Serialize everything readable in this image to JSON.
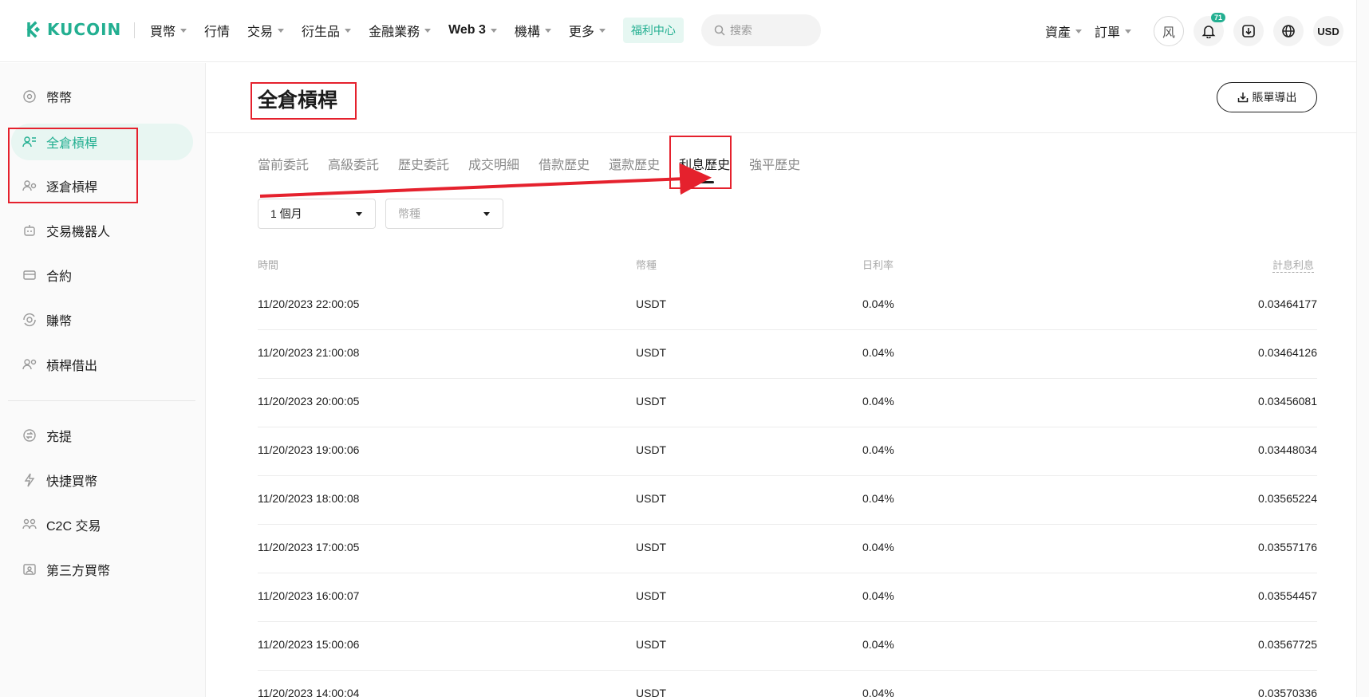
{
  "header": {
    "logo_text": "KUCOIN",
    "nav": [
      {
        "label": "買幣",
        "caret": true
      },
      {
        "label": "行情",
        "caret": false
      },
      {
        "label": "交易",
        "caret": true
      },
      {
        "label": "衍生品",
        "caret": true
      },
      {
        "label": "金融業務",
        "caret": true
      },
      {
        "label": "Web 3",
        "caret": true
      },
      {
        "label": "機構",
        "caret": true
      },
      {
        "label": "更多",
        "caret": true
      }
    ],
    "promo": "福利中心",
    "search_placeholder": "搜索",
    "assets": "資產",
    "orders": "訂單",
    "avatar": "风",
    "notification_count": "71",
    "currency": "USD"
  },
  "sidebar": {
    "items": [
      {
        "label": "幣幣",
        "icon": "coin-icon",
        "active": false
      },
      {
        "label": "全倉槓桿",
        "icon": "cross-margin-icon",
        "active": true
      },
      {
        "label": "逐倉槓桿",
        "icon": "isolated-margin-icon",
        "active": false
      },
      {
        "label": "交易機器人",
        "icon": "robot-icon",
        "active": false
      },
      {
        "label": "合約",
        "icon": "futures-icon",
        "active": false
      },
      {
        "label": "賺幣",
        "icon": "earn-icon",
        "active": false
      },
      {
        "label": "槓桿借出",
        "icon": "lending-icon",
        "active": false
      },
      {
        "label": "充提",
        "icon": "deposit-withdraw-icon",
        "active": false
      },
      {
        "label": "快捷買幣",
        "icon": "flash-icon",
        "active": false
      },
      {
        "label": "C2C 交易",
        "icon": "c2c-icon",
        "active": false
      },
      {
        "label": "第三方買幣",
        "icon": "third-party-icon",
        "active": false
      }
    ]
  },
  "main": {
    "title": "全倉槓桿",
    "export_label": "賬單導出",
    "tabs": [
      "當前委託",
      "高級委託",
      "歷史委託",
      "成交明細",
      "借款歷史",
      "還款歷史",
      "利息歷史",
      "強平歷史"
    ],
    "active_tab": "利息歷史",
    "filters": {
      "period": "1 個月",
      "currency_placeholder": "幣種"
    },
    "columns": [
      "時間",
      "幣種",
      "日利率",
      "計息利息"
    ],
    "rows": [
      {
        "time": "11/20/2023 22:00:05",
        "currency": "USDT",
        "rate": "0.04%",
        "interest": "0.03464177"
      },
      {
        "time": "11/20/2023 21:00:08",
        "currency": "USDT",
        "rate": "0.04%",
        "interest": "0.03464126"
      },
      {
        "time": "11/20/2023 20:00:05",
        "currency": "USDT",
        "rate": "0.04%",
        "interest": "0.03456081"
      },
      {
        "time": "11/20/2023 19:00:06",
        "currency": "USDT",
        "rate": "0.04%",
        "interest": "0.03448034"
      },
      {
        "time": "11/20/2023 18:00:08",
        "currency": "USDT",
        "rate": "0.04%",
        "interest": "0.03565224"
      },
      {
        "time": "11/20/2023 17:00:05",
        "currency": "USDT",
        "rate": "0.04%",
        "interest": "0.03557176"
      },
      {
        "time": "11/20/2023 16:00:07",
        "currency": "USDT",
        "rate": "0.04%",
        "interest": "0.03554457"
      },
      {
        "time": "11/20/2023 15:00:06",
        "currency": "USDT",
        "rate": "0.04%",
        "interest": "0.03567725"
      },
      {
        "time": "11/20/2023 14:00:04",
        "currency": "USDT",
        "rate": "0.04%",
        "interest": "0.03570336"
      }
    ]
  },
  "annotation_color": "#e5212d"
}
